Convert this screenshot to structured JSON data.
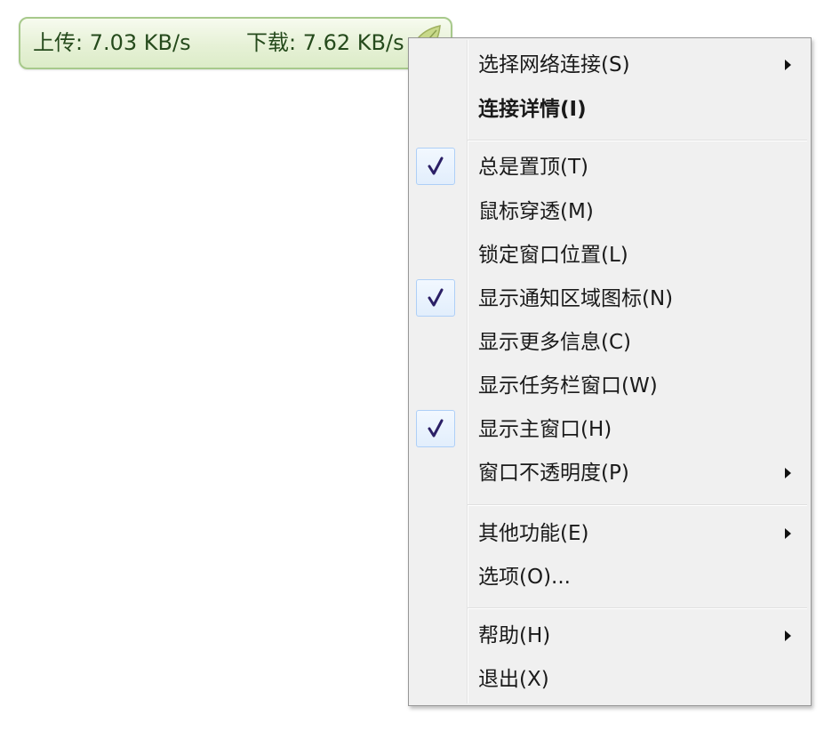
{
  "widget": {
    "upload": "上传: 7.03 KB/s",
    "download": "下载: 7.62 KB/s"
  },
  "menu": {
    "select_network": "选择网络连接(S)",
    "connection_details": "连接详情(I)",
    "always_on_top": "总是置顶(T)",
    "mouse_passthrough": "鼠标穿透(M)",
    "lock_window_position": "锁定窗口位置(L)",
    "show_tray_icon": "显示通知区域图标(N)",
    "show_more_info": "显示更多信息(C)",
    "show_taskbar_window": "显示任务栏窗口(W)",
    "show_main_window": "显示主窗口(H)",
    "window_opacity": "窗口不透明度(P)",
    "other_functions": "其他功能(E)",
    "options": "选项(O)...",
    "help": "帮助(H)",
    "exit": "退出(X)"
  },
  "checked": {
    "always_on_top": true,
    "show_tray_icon": true,
    "show_main_window": true
  },
  "colors": {
    "check_mark": "#2b1f66",
    "widget_border": "#a7c98b",
    "widget_text": "#254a1c"
  }
}
